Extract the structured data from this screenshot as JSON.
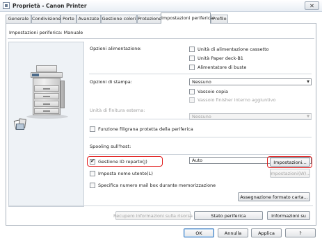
{
  "window": {
    "title": "Proprietà - Canon Printer",
    "close_glyph": "✕"
  },
  "tabs": [
    {
      "label": "Generale"
    },
    {
      "label": "Condivisione"
    },
    {
      "label": "Porte"
    },
    {
      "label": "Avanzate"
    },
    {
      "label": "Gestione colori"
    },
    {
      "label": "Protezione"
    },
    {
      "label": "Impostazioni periferica",
      "active": true
    },
    {
      "label": "Profilo"
    }
  ],
  "header": {
    "label": "Impostazioni periferica: Manuale"
  },
  "paper_source": {
    "label": "Opzioni alimentazione:",
    "options": [
      {
        "label": "Unità di alimentazione cassetto",
        "checked": false
      },
      {
        "label": "Unità Paper deck-B1",
        "checked": false
      },
      {
        "label": "Alimentatore di buste",
        "checked": false
      }
    ]
  },
  "print_options": {
    "label": "Opzioni di stampa:",
    "value": "Nessuno",
    "options": [
      {
        "label": "Vassoio copia",
        "checked": false,
        "disabled": false
      },
      {
        "label": "Vassoio finisher interno aggiuntivo",
        "checked": false,
        "disabled": true
      }
    ]
  },
  "external_finisher": {
    "label": "Unità di finitura esterna:",
    "value": "Nessuno",
    "disabled": true
  },
  "watermark": {
    "label": "Funzione filigrana protetta della periferica",
    "checked": false
  },
  "spooling": {
    "label": "Spooling sull'host:",
    "value": "Auto"
  },
  "department_id": {
    "label": "Gestione ID reparto(J)",
    "checked": true,
    "settings_button": "Impostazioni..."
  },
  "user_name": {
    "label": "Imposta nome utente(L)",
    "checked": false,
    "settings_button": "Impostazioni(W)..."
  },
  "mailbox": {
    "label": "Specifica numero mail box durante memorizzazione",
    "checked": false
  },
  "paper_format_button": "Assegnazione formato carta...",
  "bottom_buttons": {
    "retrieve_info": "Recupero informazioni sulla risorsa",
    "device_status": "Stato periferica",
    "about": "Informazioni su"
  },
  "dialog_buttons": {
    "ok": "OK",
    "cancel": "Annulla",
    "apply": "Applica",
    "help": "?"
  },
  "glyphs": {
    "check": "✔",
    "dropdown": "▼"
  },
  "colors": {
    "highlight_ring": "#e01a1a",
    "default_button_border": "#3d7bbf"
  }
}
